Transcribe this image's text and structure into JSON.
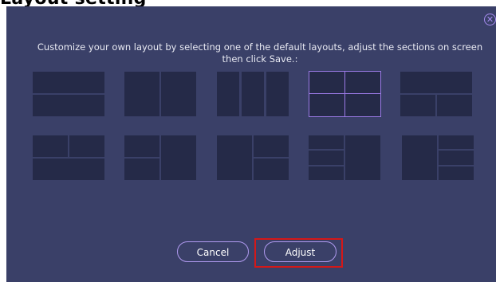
{
  "header_fragment": "Layout setting",
  "dialog": {
    "instructions": "Customize your own layout by selecting one of the default layouts, adjust the sections on screen then click Save.:",
    "close_icon": "close-circle-icon",
    "accent_color": "#9b7ae6",
    "layouts": [
      {
        "name": "layout-two-rows",
        "selected": false
      },
      {
        "name": "layout-two-columns",
        "selected": false
      },
      {
        "name": "layout-three-columns",
        "selected": false
      },
      {
        "name": "layout-grid-2x2",
        "selected": true
      },
      {
        "name": "layout-top-wide-bottom-two",
        "selected": false
      },
      {
        "name": "layout-top-two-bottom-wide",
        "selected": false
      },
      {
        "name": "layout-left-two-right-tall",
        "selected": false
      },
      {
        "name": "layout-left-tall-right-two",
        "selected": false
      },
      {
        "name": "layout-left-three-right-tall",
        "selected": false
      },
      {
        "name": "layout-left-tall-right-three",
        "selected": false
      }
    ],
    "buttons": {
      "cancel_label": "Cancel",
      "adjust_label": "Adjust"
    }
  }
}
